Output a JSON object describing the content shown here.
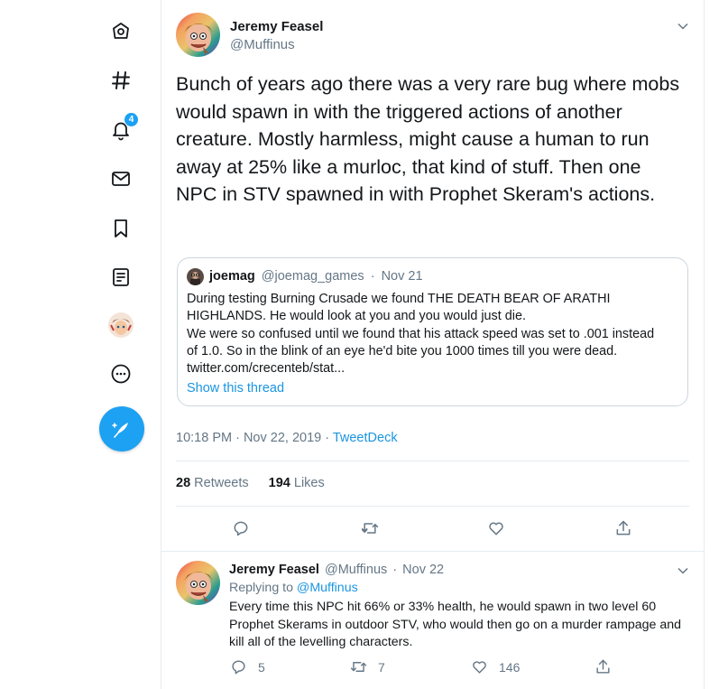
{
  "sidebar": {
    "notifications_badge": "4",
    "icons": [
      "home-icon",
      "explore-hashtag-icon",
      "notifications-bell-icon",
      "messages-envelope-icon",
      "bookmarks-icon",
      "lists-icon",
      "profile-avatar",
      "more-icon",
      "compose-tweet-icon"
    ]
  },
  "main_tweet": {
    "display_name": "Jeremy Feasel",
    "handle": "@Muffinus",
    "text": "Bunch of years ago there was a very rare bug where mobs would spawn in with the triggered actions of another creature. Mostly harmless, might cause a human to run away at 25% like a murloc, that kind of stuff. Then one NPC in STV spawned in with Prophet Skeram's actions.",
    "quoted": {
      "display_name": "joemag",
      "handle": "@joemag_games",
      "separator": "·",
      "date": "Nov 21",
      "text_lines": [
        "During testing Burning Crusade we found THE DEATH BEAR OF ARATHI",
        "HIGHLANDS. He would look at you and you would just die.",
        "We were so confused until we found that his attack speed was set to .001 instead",
        "of 1.0. So in the blink of an eye he'd bite you 1000 times till you were dead.",
        "twitter.com/crecenteb/stat..."
      ],
      "show_thread": "Show this thread"
    },
    "timestamp": "10:18 PM · Nov 22, 2019 · ",
    "source": "TweetDeck",
    "retweets_count": "28",
    "retweets_label": "Retweets",
    "likes_count": "194",
    "likes_label": "Likes"
  },
  "reply_tweet": {
    "display_name": "Jeremy Feasel",
    "handle": "@Muffinus",
    "separator": "·",
    "date": "Nov 22",
    "replying_prefix": "Replying to ",
    "replying_to": "@Muffinus",
    "text": "Every time this NPC hit 66% or 33% health, he would spawn in two level 60 Prophet Skerams in outdoor STV, who would then go on a murder rampage and kill all of the levelling characters.",
    "reply_count": "5",
    "retweet_count": "7",
    "like_count": "146"
  },
  "colors": {
    "accent": "#1da1f2",
    "link": "#1b95e0",
    "secondary_text": "#657786",
    "border": "#e6ecf0"
  }
}
